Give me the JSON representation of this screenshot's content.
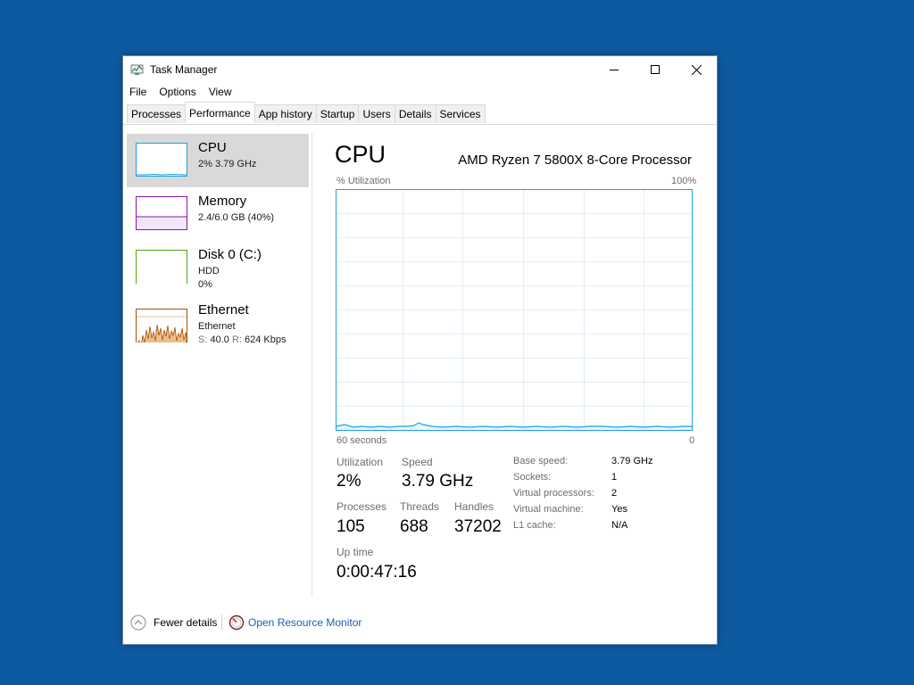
{
  "window": {
    "title": "Task Manager",
    "controls": {
      "minimize": "minimize-icon",
      "maximize": "maximize-icon",
      "close": "close-icon"
    }
  },
  "menu": [
    "File",
    "Options",
    "View"
  ],
  "tabs": [
    {
      "label": "Processes",
      "active": false
    },
    {
      "label": "Performance",
      "active": true
    },
    {
      "label": "App history",
      "active": false
    },
    {
      "label": "Startup",
      "active": false
    },
    {
      "label": "Users",
      "active": false
    },
    {
      "label": "Details",
      "active": false
    },
    {
      "label": "Services",
      "active": false
    }
  ],
  "sidebar": [
    {
      "title": "CPU",
      "line1": "2%  3.79 GHz",
      "color": "#1ba1e2",
      "selected": true
    },
    {
      "title": "Memory",
      "line1": "2.4/6.0 GB (40%)",
      "color": "#8b12ae",
      "selected": false
    },
    {
      "title": "Disk 0 (C:)",
      "line1": "HDD",
      "line2": "0%",
      "color": "#4da60c",
      "selected": false
    },
    {
      "title": "Ethernet",
      "line1": "Ethernet",
      "line2_s_label": "S:",
      "line2_s_value": "40.0",
      "line2_r_label": "R:",
      "line2_r_value": "624 Kbps",
      "color": "#a74f01",
      "selected": false
    }
  ],
  "detail": {
    "title": "CPU",
    "model": "AMD Ryzen 7 5800X 8-Core Processor",
    "graph_label": "% Utilization",
    "graph_max": "100%",
    "graph_time": "60 seconds",
    "graph_min": "0",
    "graph_color": "#1ba1e2",
    "stats": {
      "utilization_label": "Utilization",
      "utilization": "2%",
      "speed_label": "Speed",
      "speed": "3.79 GHz",
      "processes_label": "Processes",
      "processes": "105",
      "threads_label": "Threads",
      "threads": "688",
      "handles_label": "Handles",
      "handles": "37202",
      "uptime_label": "Up time",
      "uptime": "0:00:47:16"
    },
    "properties": [
      {
        "key": "Base speed:",
        "value": "3.79 GHz"
      },
      {
        "key": "Sockets:",
        "value": "1"
      },
      {
        "key": "Virtual processors:",
        "value": "2"
      },
      {
        "key": "Virtual machine:",
        "value": "Yes"
      },
      {
        "key": "L1 cache:",
        "value": "N/A"
      }
    ]
  },
  "footer": {
    "fewer_details": "Fewer details",
    "open_monitor": "Open Resource Monitor"
  }
}
